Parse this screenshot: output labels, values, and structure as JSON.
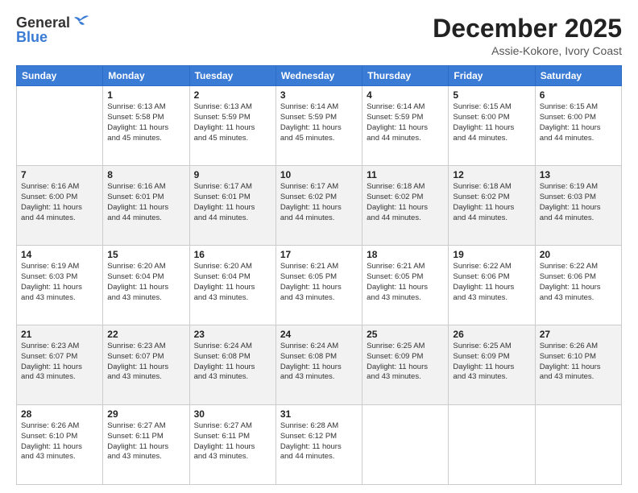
{
  "header": {
    "logo_general": "General",
    "logo_blue": "Blue",
    "month_title": "December 2025",
    "location": "Assie-Kokore, Ivory Coast"
  },
  "days_of_week": [
    "Sunday",
    "Monday",
    "Tuesday",
    "Wednesday",
    "Thursday",
    "Friday",
    "Saturday"
  ],
  "weeks": [
    [
      {
        "day": "",
        "info": ""
      },
      {
        "day": "1",
        "info": "Sunrise: 6:13 AM\nSunset: 5:58 PM\nDaylight: 11 hours\nand 45 minutes."
      },
      {
        "day": "2",
        "info": "Sunrise: 6:13 AM\nSunset: 5:59 PM\nDaylight: 11 hours\nand 45 minutes."
      },
      {
        "day": "3",
        "info": "Sunrise: 6:14 AM\nSunset: 5:59 PM\nDaylight: 11 hours\nand 45 minutes."
      },
      {
        "day": "4",
        "info": "Sunrise: 6:14 AM\nSunset: 5:59 PM\nDaylight: 11 hours\nand 44 minutes."
      },
      {
        "day": "5",
        "info": "Sunrise: 6:15 AM\nSunset: 6:00 PM\nDaylight: 11 hours\nand 44 minutes."
      },
      {
        "day": "6",
        "info": "Sunrise: 6:15 AM\nSunset: 6:00 PM\nDaylight: 11 hours\nand 44 minutes."
      }
    ],
    [
      {
        "day": "7",
        "info": "Sunrise: 6:16 AM\nSunset: 6:00 PM\nDaylight: 11 hours\nand 44 minutes."
      },
      {
        "day": "8",
        "info": "Sunrise: 6:16 AM\nSunset: 6:01 PM\nDaylight: 11 hours\nand 44 minutes."
      },
      {
        "day": "9",
        "info": "Sunrise: 6:17 AM\nSunset: 6:01 PM\nDaylight: 11 hours\nand 44 minutes."
      },
      {
        "day": "10",
        "info": "Sunrise: 6:17 AM\nSunset: 6:02 PM\nDaylight: 11 hours\nand 44 minutes."
      },
      {
        "day": "11",
        "info": "Sunrise: 6:18 AM\nSunset: 6:02 PM\nDaylight: 11 hours\nand 44 minutes."
      },
      {
        "day": "12",
        "info": "Sunrise: 6:18 AM\nSunset: 6:02 PM\nDaylight: 11 hours\nand 44 minutes."
      },
      {
        "day": "13",
        "info": "Sunrise: 6:19 AM\nSunset: 6:03 PM\nDaylight: 11 hours\nand 44 minutes."
      }
    ],
    [
      {
        "day": "14",
        "info": "Sunrise: 6:19 AM\nSunset: 6:03 PM\nDaylight: 11 hours\nand 43 minutes."
      },
      {
        "day": "15",
        "info": "Sunrise: 6:20 AM\nSunset: 6:04 PM\nDaylight: 11 hours\nand 43 minutes."
      },
      {
        "day": "16",
        "info": "Sunrise: 6:20 AM\nSunset: 6:04 PM\nDaylight: 11 hours\nand 43 minutes."
      },
      {
        "day": "17",
        "info": "Sunrise: 6:21 AM\nSunset: 6:05 PM\nDaylight: 11 hours\nand 43 minutes."
      },
      {
        "day": "18",
        "info": "Sunrise: 6:21 AM\nSunset: 6:05 PM\nDaylight: 11 hours\nand 43 minutes."
      },
      {
        "day": "19",
        "info": "Sunrise: 6:22 AM\nSunset: 6:06 PM\nDaylight: 11 hours\nand 43 minutes."
      },
      {
        "day": "20",
        "info": "Sunrise: 6:22 AM\nSunset: 6:06 PM\nDaylight: 11 hours\nand 43 minutes."
      }
    ],
    [
      {
        "day": "21",
        "info": "Sunrise: 6:23 AM\nSunset: 6:07 PM\nDaylight: 11 hours\nand 43 minutes."
      },
      {
        "day": "22",
        "info": "Sunrise: 6:23 AM\nSunset: 6:07 PM\nDaylight: 11 hours\nand 43 minutes."
      },
      {
        "day": "23",
        "info": "Sunrise: 6:24 AM\nSunset: 6:08 PM\nDaylight: 11 hours\nand 43 minutes."
      },
      {
        "day": "24",
        "info": "Sunrise: 6:24 AM\nSunset: 6:08 PM\nDaylight: 11 hours\nand 43 minutes."
      },
      {
        "day": "25",
        "info": "Sunrise: 6:25 AM\nSunset: 6:09 PM\nDaylight: 11 hours\nand 43 minutes."
      },
      {
        "day": "26",
        "info": "Sunrise: 6:25 AM\nSunset: 6:09 PM\nDaylight: 11 hours\nand 43 minutes."
      },
      {
        "day": "27",
        "info": "Sunrise: 6:26 AM\nSunset: 6:10 PM\nDaylight: 11 hours\nand 43 minutes."
      }
    ],
    [
      {
        "day": "28",
        "info": "Sunrise: 6:26 AM\nSunset: 6:10 PM\nDaylight: 11 hours\nand 43 minutes."
      },
      {
        "day": "29",
        "info": "Sunrise: 6:27 AM\nSunset: 6:11 PM\nDaylight: 11 hours\nand 43 minutes."
      },
      {
        "day": "30",
        "info": "Sunrise: 6:27 AM\nSunset: 6:11 PM\nDaylight: 11 hours\nand 43 minutes."
      },
      {
        "day": "31",
        "info": "Sunrise: 6:28 AM\nSunset: 6:12 PM\nDaylight: 11 hours\nand 44 minutes."
      },
      {
        "day": "",
        "info": ""
      },
      {
        "day": "",
        "info": ""
      },
      {
        "day": "",
        "info": ""
      }
    ]
  ]
}
